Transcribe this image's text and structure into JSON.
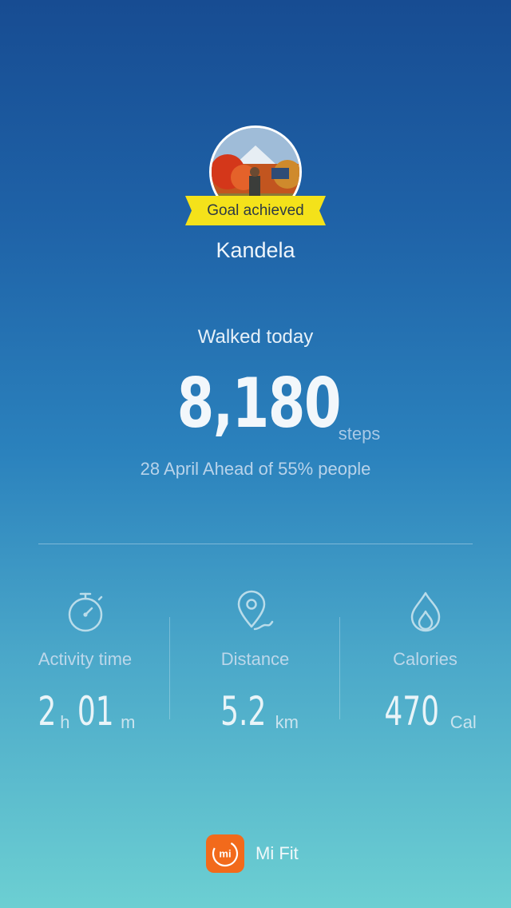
{
  "profile": {
    "name": "Kandela",
    "badge": "Goal achieved"
  },
  "today": {
    "label": "Walked today",
    "steps": "8,180",
    "unit": "steps",
    "summary": "28 April Ahead of 55% people"
  },
  "stats": {
    "activity": {
      "label": "Activity time",
      "hours": "2",
      "hours_unit": "h",
      "minutes": "01",
      "minutes_unit": "m",
      "icon": "stopwatch-icon"
    },
    "distance": {
      "label": "Distance",
      "value": "5.2",
      "unit": "km",
      "icon": "location-pin-icon"
    },
    "calories": {
      "label": "Calories",
      "value": "470",
      "unit": "Cal",
      "icon": "flame-icon"
    }
  },
  "app": {
    "name": "Mi Fit",
    "logo_text": "mi",
    "logo_color": "#f26a1b"
  },
  "colors": {
    "badge": "#f4e21a",
    "gradient_top": "#174c92",
    "gradient_bottom": "#6ccfd2"
  }
}
